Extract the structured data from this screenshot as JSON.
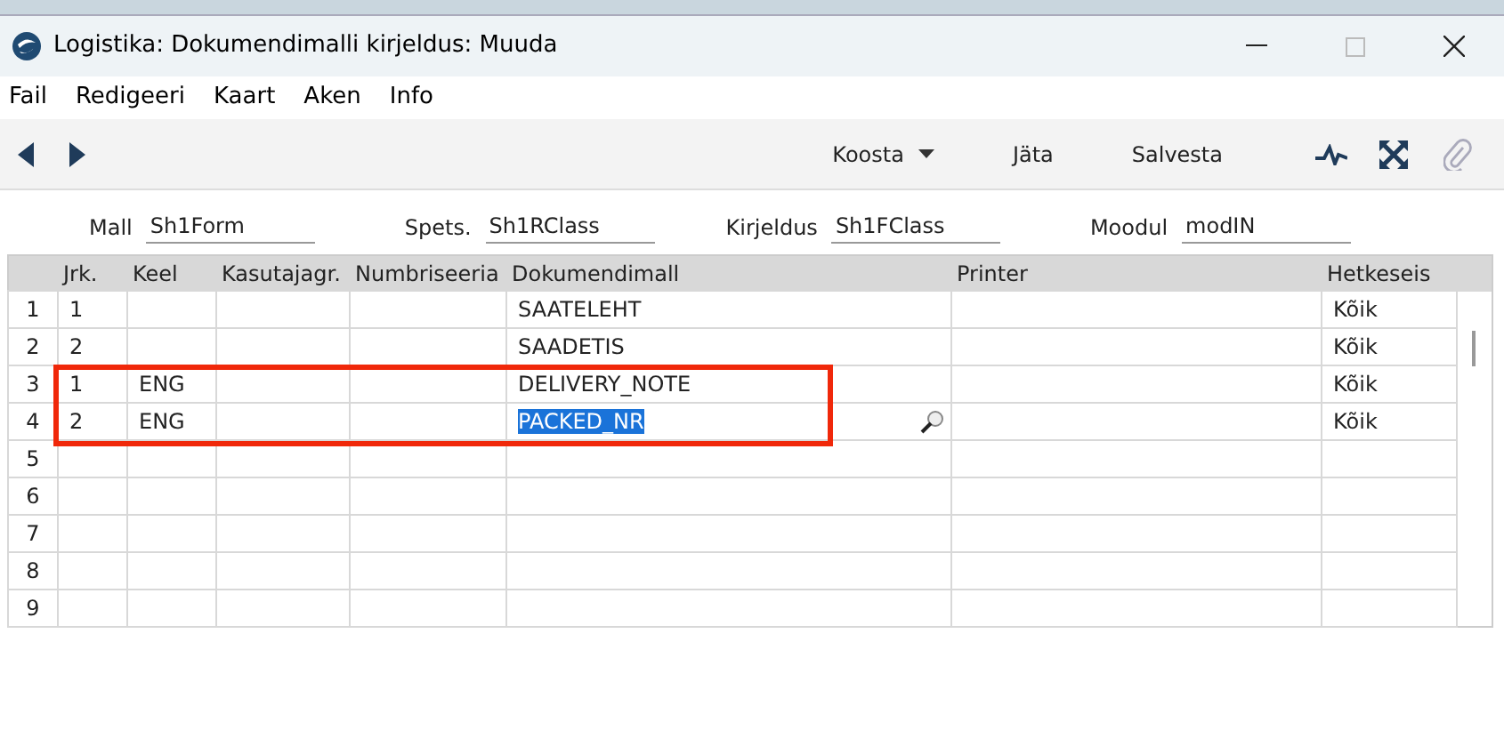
{
  "window": {
    "title": "Logistika: Dokumendimalli kirjeldus: Muuda"
  },
  "menu": [
    "Fail",
    "Redigeeri",
    "Kaart",
    "Aken",
    "Info"
  ],
  "toolbar": {
    "buttons": [
      {
        "label": "Koosta",
        "kind": "dropdown"
      },
      {
        "label": "Jäta",
        "kind": "plain"
      },
      {
        "label": "Salvesta",
        "kind": "plain"
      }
    ]
  },
  "fields": [
    {
      "label": "Mall",
      "value": "Sh1Form"
    },
    {
      "label": "Spets.",
      "value": "Sh1RClass"
    },
    {
      "label": "Kirjeldus",
      "value": "Sh1FClass"
    },
    {
      "label": "Moodul",
      "value": "modIN"
    }
  ],
  "table": {
    "columns": [
      "Jrk.",
      "Keel",
      "Kasutajagr.",
      "Numbriseeria",
      "Dokumendimall",
      "Printer",
      "Hetkeseis"
    ],
    "rows": [
      {
        "number": "1",
        "cells": [
          "1",
          "",
          "",
          "",
          "SAATELEHT",
          "",
          "Kõik"
        ],
        "outlined": false,
        "editing": false
      },
      {
        "number": "2",
        "cells": [
          "2",
          "",
          "",
          "",
          "SAADETIS",
          "",
          "Kõik"
        ],
        "outlined": false,
        "editing": false
      },
      {
        "number": "3",
        "cells": [
          "1",
          "ENG",
          "",
          "",
          "DELIVERY_NOTE",
          "",
          "Kõik"
        ],
        "outlined": true,
        "editing": false
      },
      {
        "number": "4",
        "cells": [
          "2",
          "ENG",
          "",
          "",
          "PACKED_NR",
          "",
          "Kõik"
        ],
        "outlined": true,
        "editing": true
      },
      {
        "number": "5",
        "cells": [
          "",
          "",
          "",
          "",
          "",
          "",
          ""
        ],
        "outlined": false,
        "editing": false
      },
      {
        "number": "6",
        "cells": [
          "",
          "",
          "",
          "",
          "",
          "",
          ""
        ],
        "outlined": false,
        "editing": false
      },
      {
        "number": "7",
        "cells": [
          "",
          "",
          "",
          "",
          "",
          "",
          ""
        ],
        "outlined": false,
        "editing": false
      },
      {
        "number": "8",
        "cells": [
          "",
          "",
          "",
          "",
          "",
          "",
          ""
        ],
        "outlined": false,
        "editing": false
      },
      {
        "number": "9",
        "cells": [
          "",
          "",
          "",
          "",
          "",
          "",
          ""
        ],
        "outlined": false,
        "editing": false
      }
    ]
  }
}
